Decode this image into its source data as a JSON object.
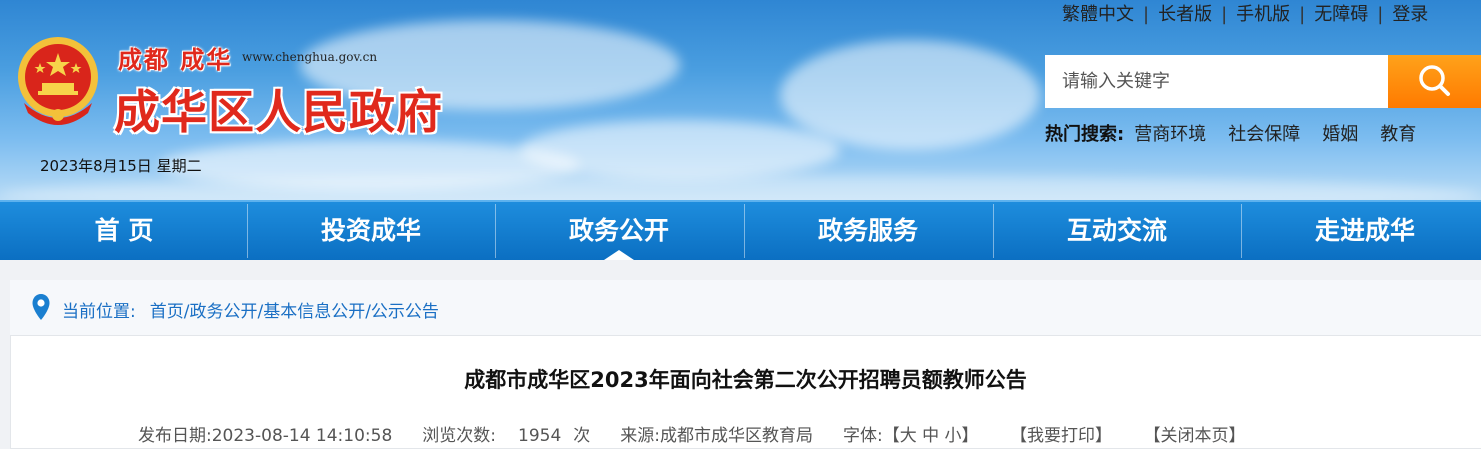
{
  "header": {
    "logo_small": "成都 成华",
    "logo_url": "www.chenghua.gov.cn",
    "logo_big": "成华区人民政府",
    "date": "2023年8月15日 星期二",
    "top_links": [
      "繁體中文",
      "长者版",
      "手机版",
      "无障碍",
      "登录"
    ],
    "search": {
      "placeholder": "请输入关键字"
    },
    "hot_search": {
      "label": "热门搜索:",
      "keywords": [
        "营商环境",
        "社会保障",
        "婚姻",
        "教育"
      ]
    }
  },
  "nav": {
    "items": [
      "首 页",
      "投资成华",
      "政务公开",
      "政务服务",
      "互动交流",
      "走进成华"
    ],
    "active_index": 2
  },
  "breadcrumb": {
    "label": "当前位置:",
    "path": "首页/政务公开/基本信息公开/公示公告"
  },
  "article": {
    "title": "成都市成华区2023年面向社会第二次公开招聘员额教师公告",
    "publish_date": "发布日期:2023-08-14 14:10:58",
    "views_label": "浏览次数:",
    "views_count": "1954",
    "views_unit": "次",
    "source": "来源:成都市成华区教育局",
    "font_label": "字体:【大 中 小】",
    "print": "【我要打印】",
    "close": "【关闭本页】"
  },
  "colors": {
    "nav_blue": "#0b6fc2",
    "logo_red": "#e0291c",
    "search_orange": "#ff8a00",
    "link_blue": "#1a6fc4"
  }
}
